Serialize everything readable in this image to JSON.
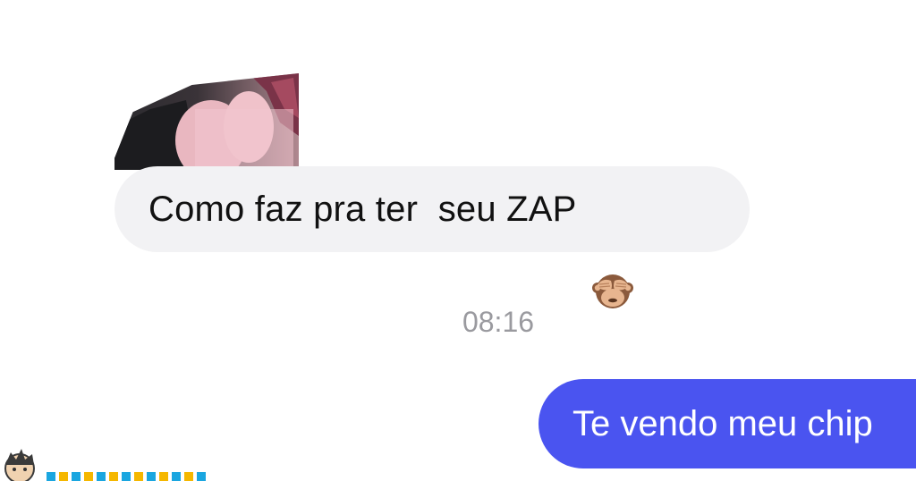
{
  "conversation": {
    "incoming_message": {
      "text": "Como faz pra ter  seu ZAP",
      "emoji": "see-no-evil-monkey-icon"
    },
    "timestamp": "08:16",
    "outgoing_message": {
      "text": "Te vendo meu chip"
    }
  },
  "colors": {
    "background": "#ffffff",
    "incoming_bubble": "#f2f2f4",
    "outgoing_bubble": "#4a54f0",
    "timestamp_text": "#9a9a9f"
  }
}
